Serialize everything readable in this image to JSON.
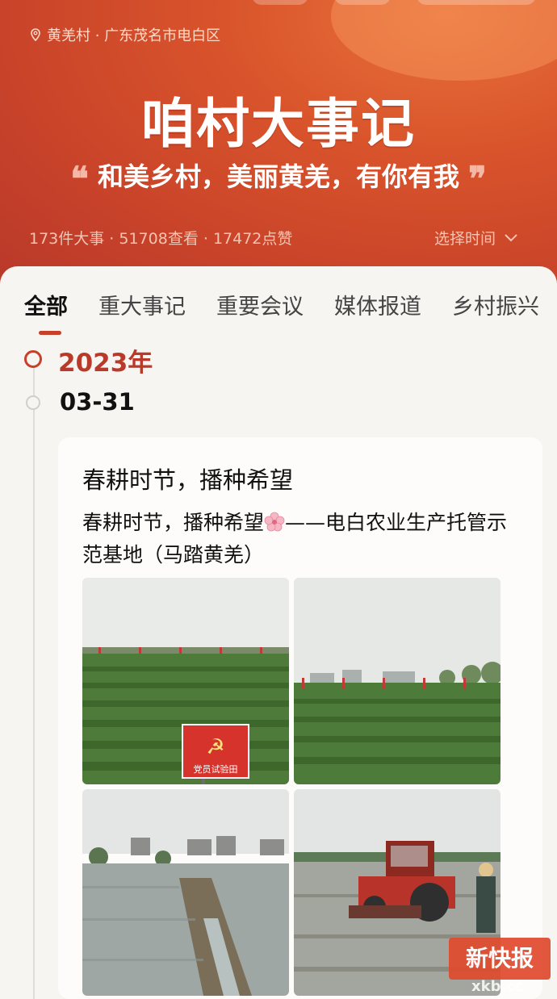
{
  "header": {
    "location": "黄羌村 · 广东茂名市电白区",
    "title": "咱村大事记",
    "slogan": "和美乡村，美丽黄羌，有你有我",
    "stats": "173件大事 · 51708查看 · 17472点赞",
    "time_select": "选择时间"
  },
  "tabs": [
    {
      "label": "全部",
      "active": true
    },
    {
      "label": "重大事记"
    },
    {
      "label": "重要会议"
    },
    {
      "label": "媒体报道"
    },
    {
      "label": "乡村振兴"
    }
  ],
  "timeline": {
    "year": "2023年",
    "date": "03-31"
  },
  "card": {
    "title": "春耕时节，播种希望",
    "desc_before": "春耕时节，播种希望",
    "desc_after": "——电白农业生产托管示范基地（马踏黄羌）",
    "sign_text": "党员试验田"
  },
  "watermark": {
    "text": "新快报",
    "sub": "xkb.cc"
  },
  "colors": {
    "accent": "#c7402a",
    "header": "#d9542b"
  }
}
